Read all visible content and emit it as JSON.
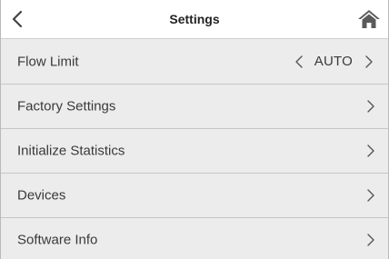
{
  "header": {
    "title": "Settings",
    "back_icon": "chevron-left-icon",
    "home_icon": "home-icon"
  },
  "items": [
    {
      "label": "Flow Limit",
      "value": "AUTO"
    },
    {
      "label": "Factory Settings"
    },
    {
      "label": "Initialize Statistics"
    },
    {
      "label": "Devices"
    },
    {
      "label": "Software Info"
    }
  ],
  "colors": {
    "list_background": "#ececec",
    "divider": "#c6c6c6",
    "text": "#3a3a3a",
    "icon": "#555555"
  }
}
